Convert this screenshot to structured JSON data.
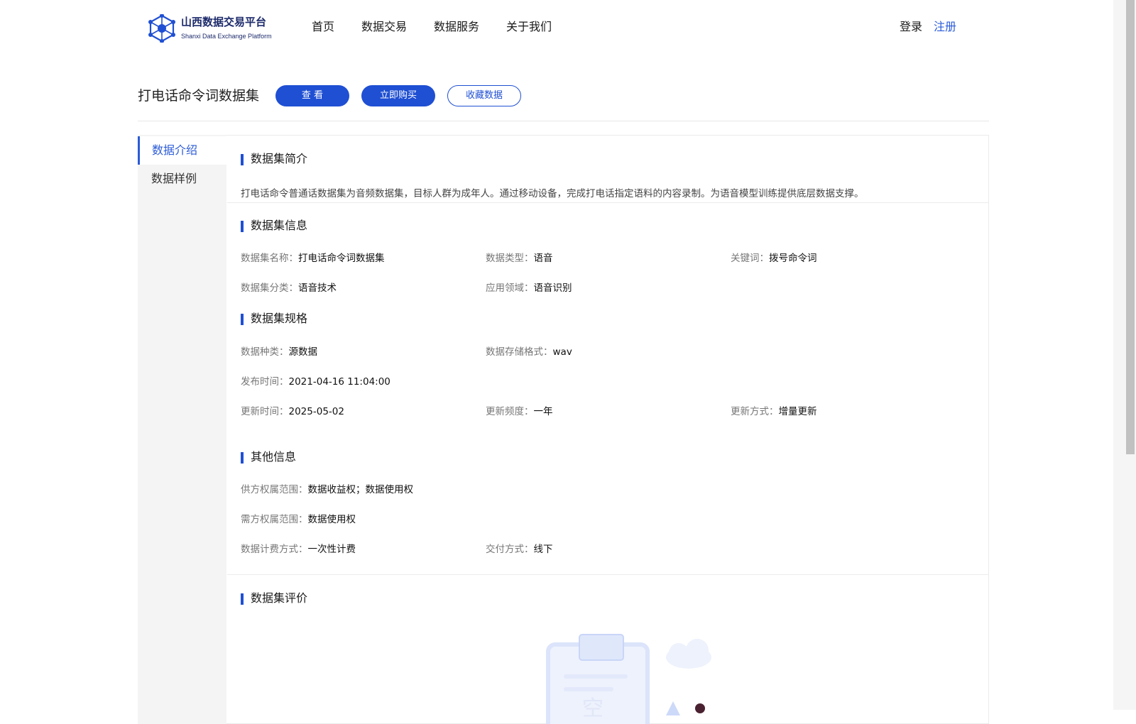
{
  "header": {
    "logo_title": "山西数据交易平台",
    "logo_subtitle": "Shanxi Data Exchange Platform",
    "nav": [
      "首页",
      "数据交易",
      "数据服务",
      "关于我们"
    ],
    "login": "登录",
    "register": "注册"
  },
  "dataset": {
    "title": "打电话命令词数据集",
    "btn_view": "查 看",
    "btn_buy": "立即购买",
    "btn_favorite": "收藏数据"
  },
  "sidebar": {
    "items": [
      "数据介绍",
      "数据样例"
    ]
  },
  "intro": {
    "heading": "数据集简介",
    "text": "打电话命令普通话数据集为音频数据集，目标人群为成年人。通过移动设备，完成打电话指定语料的内容录制。为语音模型训练提供底层数据支撑。"
  },
  "info": {
    "heading": "数据集信息",
    "name_k": "数据集名称：",
    "name_v": "打电话命令词数据集",
    "type_k": "数据类型：",
    "type_v": "语音",
    "kw_k": "关键词：",
    "kw_v": "拨号命令词",
    "cat_k": "数据集分类：",
    "cat_v": "语音技术",
    "field_k": "应用领域：",
    "field_v": "语音识别"
  },
  "spec": {
    "heading": "数据集规格",
    "kind_k": "数据种类：",
    "kind_v": "源数据",
    "fmt_k": "数据存储格式：",
    "fmt_v": "wav",
    "pub_k": "发布时间：",
    "pub_v": "2021-04-16 11:04:00",
    "upd_k": "更新时间：",
    "upd_v": "2025-05-02",
    "freq_k": "更新频度：",
    "freq_v": "一年",
    "mode_k": "更新方式：",
    "mode_v": "增量更新"
  },
  "other": {
    "heading": "其他信息",
    "supply_k": "供方权属范围：",
    "supply_v": "数据收益权；数据使用权",
    "demand_k": "需方权属范围：",
    "demand_v": "数据使用权",
    "billing_k": "数据计费方式：",
    "billing_v": "一次性计费",
    "delivery_k": "交付方式：",
    "delivery_v": "线下"
  },
  "review": {
    "heading": "数据集评价"
  },
  "colors": {
    "primary": "#1f4fd3",
    "link": "#2b5bd7",
    "sidebar_bg": "#f4f4f4"
  }
}
